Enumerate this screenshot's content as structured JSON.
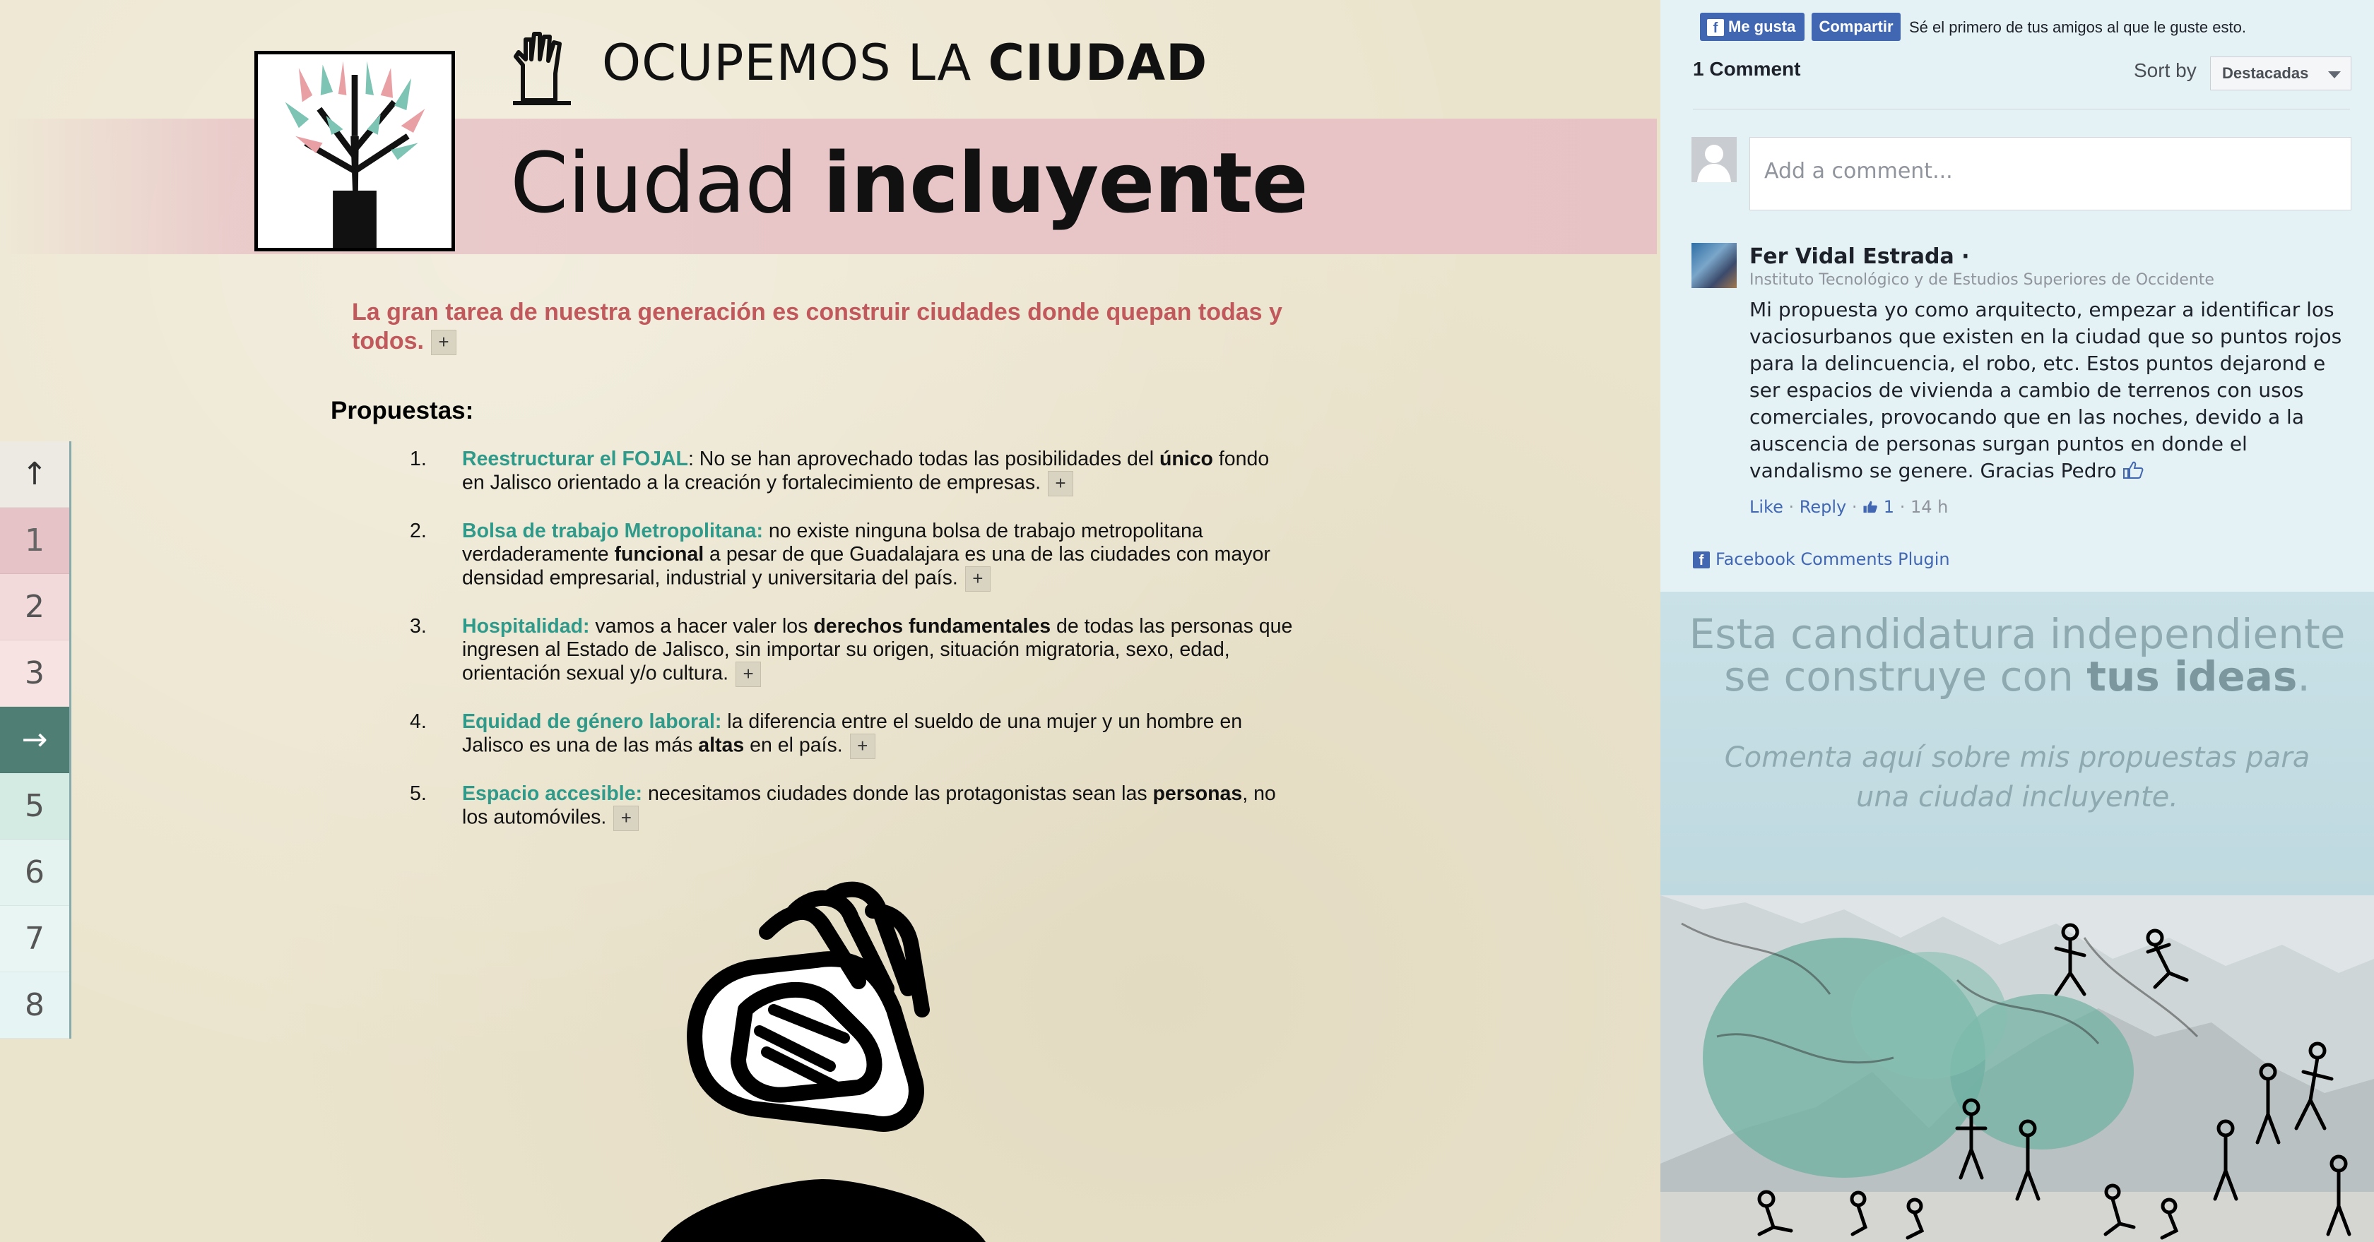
{
  "brand": {
    "prefix": "OCUPEMOS LA ",
    "bold": "CIUDAD"
  },
  "page_title": {
    "prefix": "Ciudad ",
    "bold": "incluyente"
  },
  "intro": "La gran tarea de nuestra generación es construir ciudades donde quepan todas y todos.",
  "plus_symbol": "+",
  "proposals_heading": "Propuestas:",
  "proposals": [
    {
      "num": "1.",
      "title": "Reestructurar el FOJAL",
      "parts": [
        ": No se han aprovechado todas las posibilidades del ",
        "único",
        " fondo en Jalisco orientado a la creación y fortalecimiento de empresas."
      ]
    },
    {
      "num": "2.",
      "title": "Bolsa de trabajo Metropolitana:",
      "parts": [
        " no existe ninguna bolsa de trabajo metropolitana verdaderamente ",
        "funcional",
        " a pesar de que Guadalajara es una de las ciudades con mayor densidad empresarial, industrial y universitaria del país."
      ]
    },
    {
      "num": "3.",
      "title": "Hospitalidad:",
      "parts": [
        " vamos a hacer valer los ",
        "derechos fundamentales",
        " de todas las personas que ingresen al Estado de Jalisco, sin importar su origen, situación migratoria, sexo, edad, orientación sexual y/o cultura."
      ]
    },
    {
      "num": "4.",
      "title": "Equidad de género laboral:",
      "parts": [
        " la diferencia entre el sueldo de una mujer y un hombre en Jalisco es una de las más ",
        "altas",
        " en el país."
      ]
    },
    {
      "num": "5.",
      "title": "Espacio accesible:",
      "parts": [
        " necesitamos ciudades donde las protagonistas sean las ",
        "personas",
        ", no los automóviles."
      ]
    }
  ],
  "sidenav": [
    {
      "label": "↑",
      "bg": "#eceae3",
      "color": "#333"
    },
    {
      "label": "1",
      "bg": "#e6c3c6",
      "color": "#666"
    },
    {
      "label": "2",
      "bg": "#f2d9da",
      "color": "#555"
    },
    {
      "label": "3",
      "bg": "#f6e3e2",
      "color": "#555"
    },
    {
      "label": "→",
      "bg": "#4f7f74",
      "color": "#ffffff"
    },
    {
      "label": "5",
      "bg": "#d4ebe3",
      "color": "#555"
    },
    {
      "label": "6",
      "bg": "#e4f3ef",
      "color": "#555"
    },
    {
      "label": "7",
      "bg": "#e8f5f3",
      "color": "#555"
    },
    {
      "label": "8",
      "bg": "#e6f4f3",
      "color": "#555"
    }
  ],
  "facebook": {
    "like_label": "Me gusta",
    "share_label": "Compartir",
    "social_text": "Sé el primero de tus amigos al que le guste esto.",
    "comment_count": "1 Comment",
    "sort_label": "Sort by",
    "sort_value": "Destacadas",
    "add_comment_placeholder": "Add a comment...",
    "comment": {
      "author": "Fer Vidal Estrada ·",
      "org": "Instituto Tecnológico y de Estudios Superiores de Occidente",
      "text": "Mi propuesta yo como arquitecto, empezar a identificar los vaciosurbanos que existen en la ciudad que so puntos rojos para la delincuencia, el robo, etc. Estos puntos dejarond e ser espacios de vivienda a cambio de terrenos con usos comerciales, provocando que en las noches, devido a la auscencia de personas surgan puntos en donde el vandalismo se genere. Gracias Pedro",
      "like": "Like",
      "reply": "Reply",
      "likes_count": "1",
      "time": "14 h"
    },
    "plugin_label": "Facebook Comments Plugin"
  },
  "cta": {
    "line1": "Esta candidatura independiente",
    "line2_prefix": "se construye con ",
    "line2_bold": "tus ideas",
    "line2_suffix": ".",
    "sub1": "Comenta aquí sobre mis propuestas para",
    "sub2": "una ciudad incluyente."
  },
  "colors": {
    "accent_green": "#2f9a8a",
    "accent_red": "#c0585c",
    "fb_blue": "#4267b2",
    "nav_active": "#4f7f74"
  }
}
